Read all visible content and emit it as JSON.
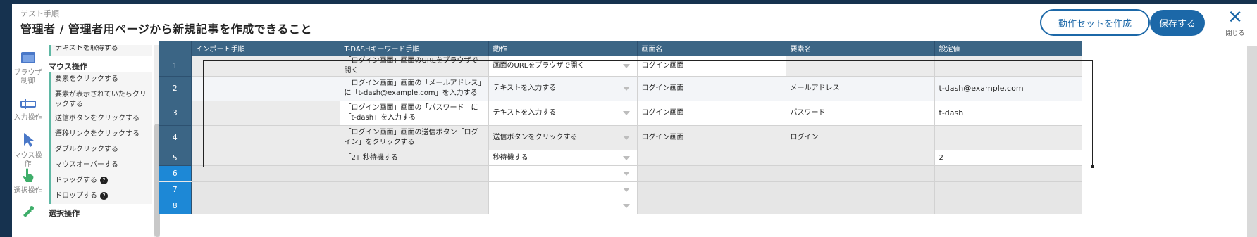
{
  "header": {
    "breadcrumb": "テスト手順",
    "title": "管理者 / 管理者用ページから新規記事を作成できること",
    "create_set_label": "動作セットを作成",
    "save_label": "保存する",
    "close_label": "閉じる"
  },
  "rail": [
    {
      "label": "ブラウザ\n制御",
      "icon": "browser-window-icon"
    },
    {
      "label": "入力操作",
      "icon": "input-cursor-icon"
    },
    {
      "label": "マウス操作",
      "icon": "mouse-pointer-icon"
    },
    {
      "label": "選択操作",
      "icon": "hand-pointer-icon"
    },
    {
      "label": "",
      "icon": "tools-icon"
    }
  ],
  "palette": {
    "top_item": "テキストを取得する",
    "mouse_heading": "マウス操作",
    "mouse_items": [
      "要素をクリックする",
      "要素が表示されていたらクリックする",
      "送信ボタンをクリックする",
      "遷移リンクをクリックする",
      "ダブルクリックする",
      "マウスオーバーする",
      "ドラッグする",
      "ドロップする"
    ],
    "select_heading": "選択操作"
  },
  "table": {
    "columns": [
      "インポート手順",
      "T-DASHキーワード手順",
      "動作",
      "画面名",
      "要素名",
      "設定値"
    ],
    "rows": [
      {
        "num": "1",
        "import": "",
        "keyword": "「ログイン画面」画面のURLをブラウザで開く",
        "action": "画面のURLをブラウザで開く",
        "screen": "ログイン画面",
        "element": "",
        "value": ""
      },
      {
        "num": "2",
        "import": "",
        "keyword": "「ログイン画面」画面の「メールアドレス」に「t-dash@example.com」を入力する",
        "action": "テキストを入力する",
        "screen": "ログイン画面",
        "element": "メールアドレス",
        "value": "t-dash@example.com"
      },
      {
        "num": "3",
        "import": "",
        "keyword": "「ログイン画面」画面の「パスワード」に「t-dash」を入力する",
        "action": "テキストを入力する",
        "screen": "ログイン画面",
        "element": "パスワード",
        "value": "t-dash"
      },
      {
        "num": "4",
        "import": "",
        "keyword": "「ログイン画面」画面の送信ボタン「ログイン」をクリックする",
        "action": "送信ボタンをクリックする",
        "screen": "ログイン画面",
        "element": "ログイン",
        "value": ""
      },
      {
        "num": "5",
        "import": "",
        "keyword": "「2」秒待機する",
        "action": "秒待機する",
        "screen": "",
        "element": "",
        "value": "2"
      },
      {
        "num": "6",
        "import": "",
        "keyword": "",
        "action": "",
        "screen": "",
        "element": "",
        "value": ""
      },
      {
        "num": "7",
        "import": "",
        "keyword": "",
        "action": "",
        "screen": "",
        "element": "",
        "value": ""
      },
      {
        "num": "8",
        "import": "",
        "keyword": "",
        "action": "",
        "screen": "",
        "element": "",
        "value": ""
      }
    ]
  },
  "colors": {
    "accent": "#1c68a8",
    "header_bg": "#3b6585",
    "row_number_empty": "#1d88d6",
    "palette_marker": "#5fb8a4"
  }
}
